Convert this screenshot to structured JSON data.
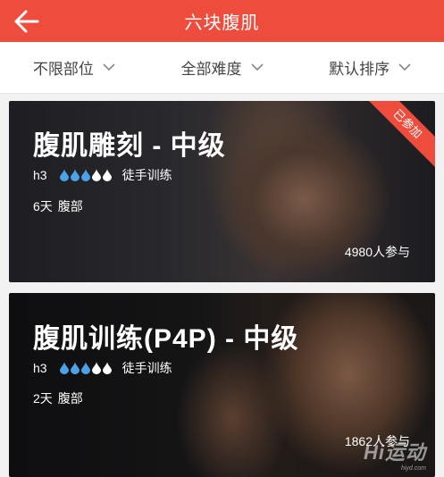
{
  "colors": {
    "accent": "#ee4d3d",
    "drop_filled": "#4aa3e8",
    "drop_empty": "#ffffff"
  },
  "header": {
    "title": "六块腹肌",
    "back_icon": "arrow-left-icon"
  },
  "filters": [
    {
      "label": "不限部位",
      "icon": "chevron-down-icon"
    },
    {
      "label": "全部难度",
      "icon": "chevron-down-icon"
    },
    {
      "label": "默认排序",
      "icon": "chevron-down-icon"
    }
  ],
  "courses": [
    {
      "name": "腹肌雕刻 - 中级",
      "level": "h3",
      "difficulty_filled": 3,
      "difficulty_total": 5,
      "equipment": "徒手训练",
      "days": "6天",
      "part": "腹部",
      "participants": "4980人参与",
      "badge": "已参加"
    },
    {
      "name": "腹肌训练(P4P) - 中级",
      "level": "h3",
      "difficulty_filled": 3,
      "difficulty_total": 5,
      "equipment": "徒手训练",
      "days": "2天",
      "part": "腹部",
      "participants": "1862人参与"
    }
  ],
  "watermark": {
    "text": "Hi运动",
    "sub": "hiyd.com"
  }
}
